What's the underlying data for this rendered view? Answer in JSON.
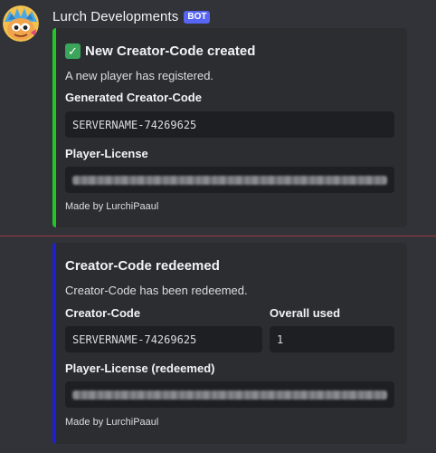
{
  "message": {
    "author": "Lurch Developments",
    "badge": "BOT"
  },
  "embeds": [
    {
      "color": "#23c52b",
      "title_icon": "check-mark-icon",
      "title": "New Creator-Code created",
      "description": "A new player has registered.",
      "fields": [
        {
          "name": "Generated Creator-Code",
          "value": "SERVERNAME-74269625"
        },
        {
          "name": "Player-License",
          "value": ""
        }
      ],
      "footer": "Made by LurchiPaaul"
    },
    {
      "color": "#1d1fd0",
      "title": "Creator-Code redeemed",
      "description": "Creator-Code has been redeemed.",
      "fields": [
        {
          "name": "Creator-Code",
          "value": "SERVERNAME-74269625"
        },
        {
          "name": "Overall used",
          "value": "1"
        },
        {
          "name": "Player-License (redeemed)",
          "value": ""
        }
      ],
      "footer": "Made by LurchiPaaul"
    }
  ],
  "colors": {
    "background": "#313338",
    "embed_background": "#2b2d31",
    "code_background": "#1e1f22",
    "new_message_divider": "#9a3a40",
    "bot_badge": "#5865f2"
  }
}
